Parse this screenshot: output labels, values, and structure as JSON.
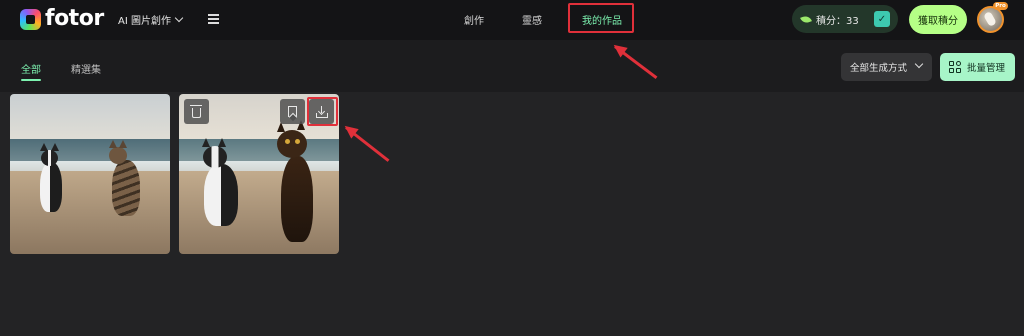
{
  "header": {
    "logo_text": "fotor",
    "ai_menu_label": "AI 圖片創作",
    "nav": {
      "create": "創作",
      "inspire": "靈感",
      "my_works": "我的作品"
    },
    "points_text": "積分：33",
    "get_points_label": "獲取積分",
    "avatar_badge": "Pro"
  },
  "toolbar": {
    "tabs": {
      "all": "全部",
      "featured": "精選集"
    },
    "sort_label": "全部生成方式",
    "batch_label": "批量管理"
  },
  "colors": {
    "accent_green": "#7df2b0",
    "highlight_red": "#e0303a",
    "points_bg": "#23372a",
    "get_points_bg": "#b5ff86"
  },
  "icons": {
    "card_actions": [
      "trash-icon",
      "bookmark-icon",
      "download-icon"
    ],
    "header": [
      "chevron-down-icon",
      "hamburger-icon",
      "leaf-icon",
      "clipboard-check-icon"
    ]
  }
}
